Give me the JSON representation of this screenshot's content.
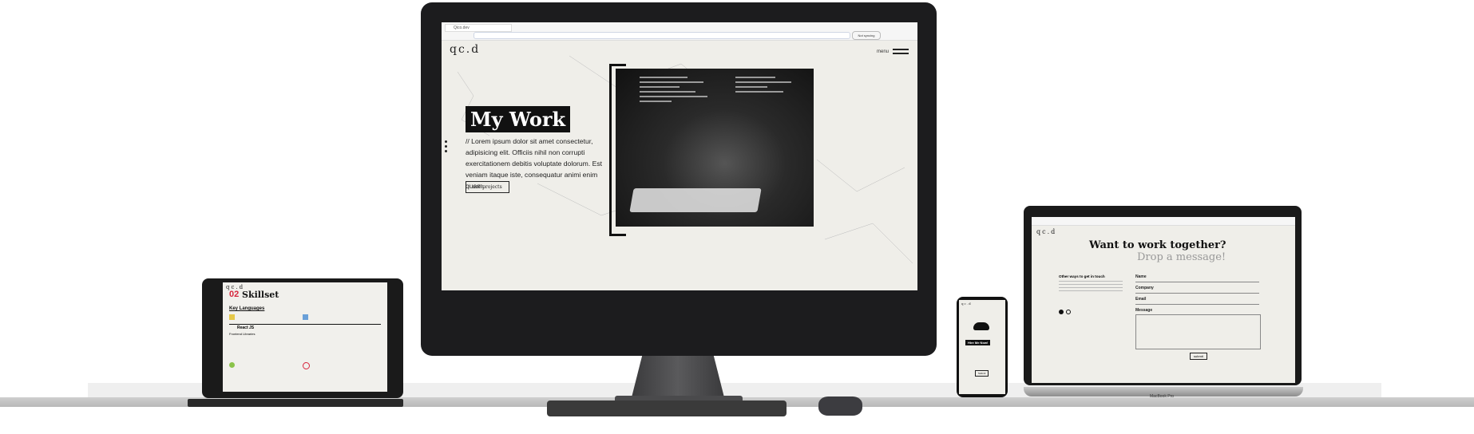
{
  "imac": {
    "browser": {
      "tab_title": "Qico.dev",
      "profile_button": "Not syncing"
    },
    "site": {
      "logo": "qc.d",
      "menu_label": "menu",
      "heading": "My Work",
      "body": "// Lorem ipsum dolor sit amet consectetur, adipisicing elit. Officiis nihil non corrupti exercitationem debitis voluptate dolorum. Est veniam itaque iste, consequatur animi enim quam.",
      "cta": "see projects"
    }
  },
  "ipad": {
    "logo": "qc.d",
    "section_number": "02",
    "section_title": "Skillset",
    "subheading": "Key Languages",
    "item_title": "React JS",
    "item_subtitle": "Frontend Libraries"
  },
  "phone": {
    "logo": "qc.d",
    "heading": "Hire Me Now!",
    "button": "Submit"
  },
  "macbook": {
    "logo": "qc.d",
    "heading": "Want to work together?",
    "subheading": "Drop a message!",
    "left_title": "Other ways to get in touch",
    "fields": [
      "Name",
      "Company",
      "Email",
      "Message"
    ],
    "submit": "submit",
    "bezel_label": "MacBook Pro"
  },
  "colors": {
    "accent_red": "#d7263d",
    "screen_bg": "#efeee9",
    "ink": "#111111"
  }
}
